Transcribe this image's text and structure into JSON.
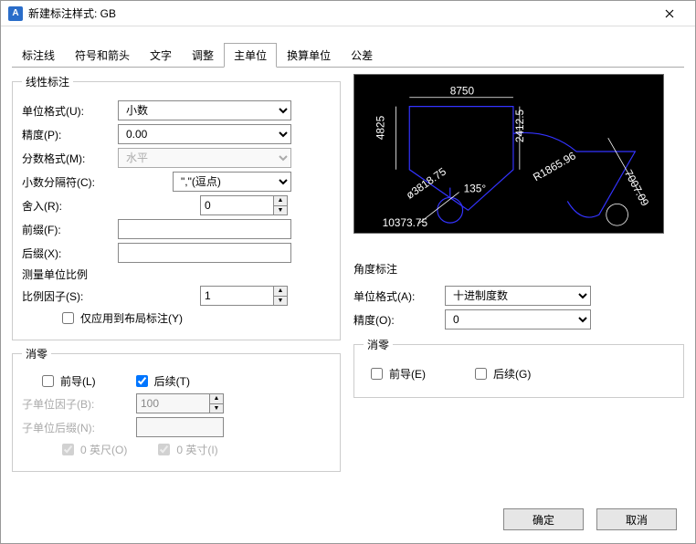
{
  "title": "新建标注样式: GB",
  "tabs": [
    "标注线",
    "符号和箭头",
    "文字",
    "调整",
    "主单位",
    "换算单位",
    "公差"
  ],
  "activeTab": 4,
  "linear": {
    "legend": "线性标注",
    "unitFormatLabel": "单位格式(U):",
    "unitFormat": "小数",
    "precisionLabel": "精度(P):",
    "precision": "0.00",
    "fractionFormatLabel": "分数格式(M):",
    "fractionFormat": "水平",
    "decimalSepLabel": "小数分隔符(C):",
    "decimalSep": "\",\"(逗点)",
    "roundLabel": "舍入(R):",
    "round": "0",
    "prefixLabel": "前缀(F):",
    "prefix": "",
    "suffixLabel": "后缀(X):",
    "suffix": ""
  },
  "scale": {
    "legend": "测量单位比例",
    "scaleFactorLabel": "比例因子(S):",
    "scaleFactor": "1",
    "layoutOnly": "仅应用到布局标注(Y)"
  },
  "zero": {
    "legend": "消零",
    "leading": "前导(L)",
    "trailing": "后续(T)",
    "subFactorLabel": "子单位因子(B):",
    "subFactor": "100",
    "subSuffixLabel": "子单位后缀(N):",
    "subSuffix": "",
    "feet": "0 英尺(O)",
    "inch": "0 英寸(I)"
  },
  "angle": {
    "legend": "角度标注",
    "unitFormatLabel": "单位格式(A):",
    "unitFormat": "十进制度数",
    "precisionLabel": "精度(O):",
    "precision": "0",
    "zeroLegend": "消零",
    "leading": "前导(E)",
    "trailing": "后续(G)"
  },
  "preview": {
    "dim_top": "8750",
    "dim_left": "4825",
    "dim_mid": "2412.5",
    "r_label": "R1865.96",
    "phi_label": "ø3818.75",
    "angle_label": "135°",
    "diag": "7007.09",
    "base": "10373.75"
  },
  "buttons": {
    "ok": "确定",
    "cancel": "取消"
  }
}
